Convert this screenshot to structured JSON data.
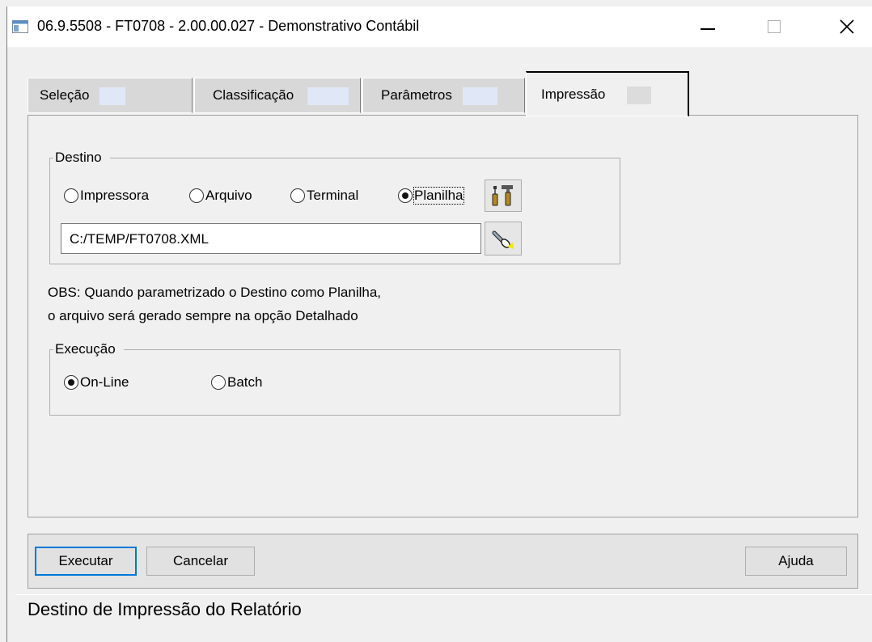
{
  "window": {
    "title": "06.9.5508 - FT0708 - 2.00.00.027 - Demonstrativo Contábil",
    "controls": {
      "minimize": "minimize",
      "maximize": "maximize",
      "close": "close"
    }
  },
  "tabs": [
    {
      "label": "Seleção",
      "active": false
    },
    {
      "label": "Classificação",
      "active": false
    },
    {
      "label": "Parâmetros",
      "active": false
    },
    {
      "label": "Impressão",
      "active": true
    }
  ],
  "destino": {
    "legend": "Destino",
    "options": [
      {
        "label": "Impressora",
        "selected": false
      },
      {
        "label": "Arquivo",
        "selected": false
      },
      {
        "label": "Terminal",
        "selected": false
      },
      {
        "label": "Planilha",
        "selected": true
      }
    ],
    "config_icon": "tools-icon",
    "file_path": "C:/TEMP/FT0708.XML",
    "browse_icon": "flashlight-icon"
  },
  "obs": {
    "line1": "OBS: Quando parametrizado o Destino como Planilha,",
    "line2": "o arquivo será gerado sempre na opção Detalhado"
  },
  "execucao": {
    "legend": "Execução",
    "options": [
      {
        "label": "On-Line",
        "selected": true
      },
      {
        "label": "Batch",
        "selected": false
      }
    ]
  },
  "buttons": {
    "executar": "Executar",
    "cancelar": "Cancelar",
    "ajuda": "Ajuda"
  },
  "status_text": "Destino de Impressão do Relatório",
  "colors": {
    "default_button_border": "#0078d7",
    "window_bg": "#f0f0f0"
  }
}
